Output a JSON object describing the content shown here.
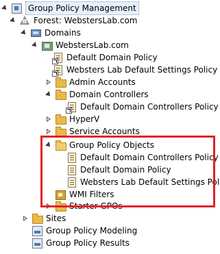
{
  "tree": {
    "root": "Group Policy Management",
    "forest": "Forest: WebstersLab.com",
    "domains": "Domains",
    "domain": "WebstersLab.com",
    "items": {
      "default_domain_policy_link": "Default Domain Policy",
      "websters_default_link": "Websters Lab Default Settings Policy",
      "admin_accounts": "Admin Accounts",
      "domain_controllers": "Domain Controllers",
      "ddcp_link": "Default Domain Controllers Policy",
      "hyperv": "HyperV",
      "service_accounts": "Service Accounts",
      "gpo_folder": "Group Policy Objects",
      "gpo_ddcp": "Default Domain Controllers Policy",
      "gpo_ddp": "Default Domain Policy",
      "gpo_websters": "Websters Lab Default Settings Policy",
      "wmi_filters": "WMI Filters",
      "starter_gpos": "Starter GPOs",
      "sites": "Sites",
      "modeling": "Group Policy Modeling",
      "results": "Group Policy Results"
    }
  },
  "colors": {
    "highlight": "#e0202b",
    "folder": "#e9b94a"
  }
}
